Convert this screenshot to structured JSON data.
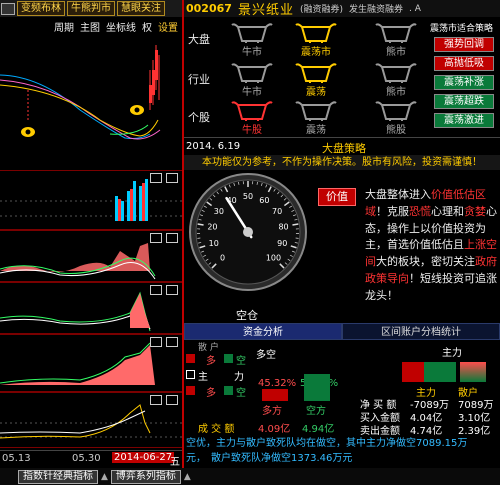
{
  "toolbar": {
    "buttons": [
      "变频布林",
      "牛熊判市",
      "慧眼关注"
    ]
  },
  "chart_menu": [
    "周期",
    "主图",
    "坐标线",
    "权",
    "设置"
  ],
  "date_axis": {
    "d1": "05.13",
    "d2": "05.30",
    "current": "2014-06-27",
    "weekday": "五"
  },
  "header": {
    "code": "002067",
    "name": "景兴纸业",
    "tag1": "(融资融券)",
    "tag2": "发生融资融券",
    "trail": ". A"
  },
  "strategy": {
    "rows": [
      {
        "label": "大盘",
        "items": [
          {
            "name": "牛市",
            "active": false
          },
          {
            "name": "震荡市",
            "active": true
          },
          {
            "name": "熊市",
            "active": false
          }
        ]
      },
      {
        "label": "行业",
        "items": [
          {
            "name": "牛市",
            "active": false
          },
          {
            "name": "震荡",
            "active": true
          },
          {
            "name": "熊市",
            "active": false
          }
        ]
      },
      {
        "label": "个股",
        "items": [
          {
            "name": "牛股",
            "active": true
          },
          {
            "name": "震荡",
            "active": false
          },
          {
            "name": "熊股",
            "active": false
          }
        ]
      }
    ],
    "right_title": "震荡市适合策略",
    "right_buttons": [
      {
        "label": "强势回调",
        "color": "#c00000"
      },
      {
        "label": "高抛低吸",
        "color": "#c00000"
      },
      {
        "label": "震荡补涨",
        "color": "#0a7a3a"
      },
      {
        "label": "震荡超跌",
        "color": "#0a7a3a"
      },
      {
        "label": "震荡激进",
        "color": "#0a7a3a"
      }
    ]
  },
  "section": {
    "date": "2014. 6.19",
    "title": "大盘策略"
  },
  "disclaimer": "本功能仅为参考，不作为操作决策。股市有风险，投资需谨慎！",
  "gauge": {
    "ticks": [
      "0",
      "10",
      "20",
      "30",
      "40",
      "50",
      "60",
      "70",
      "80",
      "90",
      "100"
    ],
    "value": 38,
    "caption": "空仓"
  },
  "comment": {
    "button": "价值",
    "text_parts": [
      {
        "t": "大盘整体进入",
        "c": "#eee"
      },
      {
        "t": "价值低估区域",
        "c": "#ff3333"
      },
      {
        "t": "！克服",
        "c": "#eee"
      },
      {
        "t": "恐慌",
        "c": "#ff3333"
      },
      {
        "t": "心理和",
        "c": "#eee"
      },
      {
        "t": "贪婪",
        "c": "#ff3333"
      },
      {
        "t": "心态，操作上以价值投资为主，首选价值低估且",
        "c": "#eee"
      },
      {
        "t": "上涨空间",
        "c": "#ff3333"
      },
      {
        "t": "大的板块，密切关注",
        "c": "#eee"
      },
      {
        "t": "政府政策导向",
        "c": "#ff3333"
      },
      {
        "t": "！短线投资可追涨龙头！",
        "c": "#eee"
      }
    ]
  },
  "tabs": [
    "资金分析",
    "区间账户分档统计"
  ],
  "fund": {
    "legend_top": "散 户",
    "legend_big": "多",
    "legend_kong": "空",
    "duokong_label": "多空",
    "zhu": "主",
    "li": "力",
    "duo_pct": "45.32%",
    "kong_pct": "54.68%",
    "duofang": "多方",
    "kongfang": "空方",
    "cjl": "成 交 额",
    "duo_amt": "4.09亿",
    "kong_amt": "4.94亿",
    "zhuli_title": "主力",
    "col_zhuli": "主力",
    "col_sanhu": "散户",
    "rows": [
      {
        "label": "净 买 额",
        "zhuli": "-7089万",
        "sanhu": "7089万"
      },
      {
        "label": "买入金额",
        "zhuli": "4.04亿",
        "sanhu": "3.10亿"
      },
      {
        "label": "卖出金额",
        "zhuli": "4.74亿",
        "sanhu": "2.39亿"
      }
    ]
  },
  "ticker": {
    "line1": "空优，主力与散户致死队均在做空，其中主力净做空7089.15万",
    "line2": "元，　散户致死队净做空1373.46万元"
  },
  "bottom_buttons": [
    "指数针经典指标",
    "博弈系列指标"
  ],
  "colors": {
    "red": "#c00000",
    "green": "#0a7a3a",
    "yellow": "#ffcc00",
    "blue": "#33bbff"
  }
}
